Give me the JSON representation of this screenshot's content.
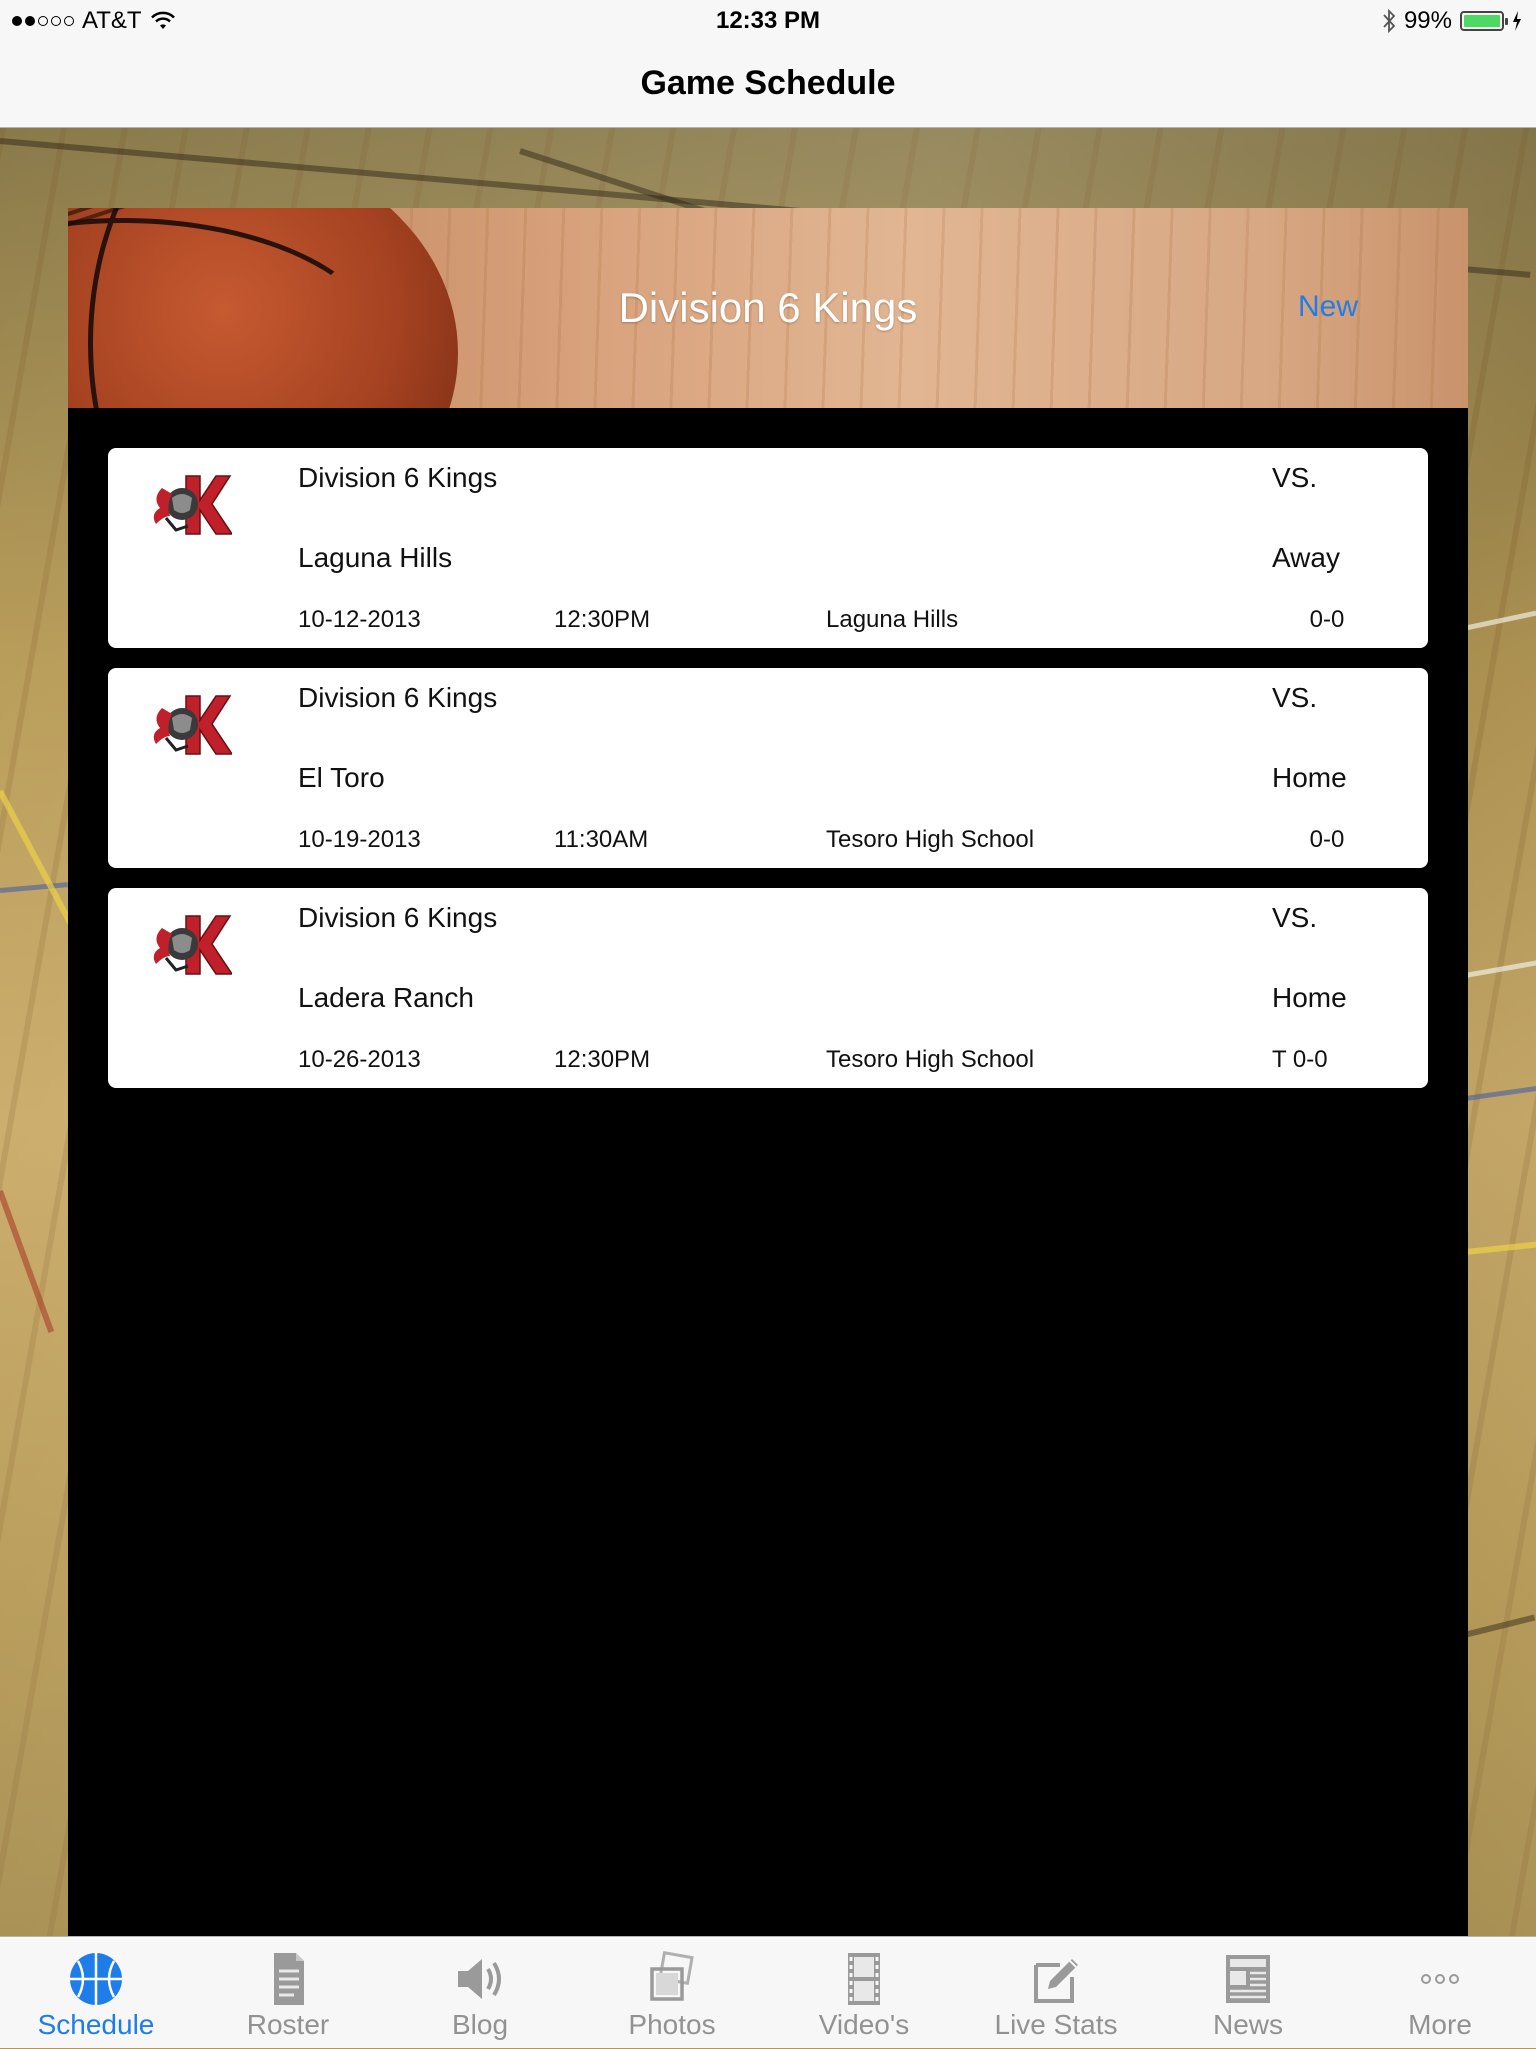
{
  "status_bar": {
    "carrier": "AT&T",
    "time": "12:33 PM",
    "battery_percent": "99%",
    "battery_level": 0.99,
    "signal_bars_filled": 2,
    "signal_bars_total": 5
  },
  "nav": {
    "title": "Game Schedule"
  },
  "header": {
    "title": "Division 6 Kings",
    "new_label": "New"
  },
  "games": [
    {
      "team": "Division 6 Kings",
      "vs": "VS.",
      "opponent": "Laguna Hills",
      "home_away": "Away",
      "date": "10-12-2013",
      "time": "12:30PM",
      "location": "Laguna Hills",
      "score": "0-0"
    },
    {
      "team": "Division 6 Kings",
      "vs": "VS.",
      "opponent": "El Toro",
      "home_away": "Home",
      "date": "10-19-2013",
      "time": "11:30AM",
      "location": "Tesoro High School",
      "score": "0-0"
    },
    {
      "team": "Division 6 Kings",
      "vs": "VS.",
      "opponent": "Ladera Ranch",
      "home_away": "Home",
      "date": "10-26-2013",
      "time": "12:30PM",
      "location": "Tesoro High School",
      "score": "T 0-0"
    }
  ],
  "tabs": [
    {
      "label": "Schedule",
      "icon": "basketball-icon",
      "active": true
    },
    {
      "label": "Roster",
      "icon": "document-icon",
      "active": false
    },
    {
      "label": "Blog",
      "icon": "speaker-icon",
      "active": false
    },
    {
      "label": "Photos",
      "icon": "photos-icon",
      "active": false
    },
    {
      "label": "Video's",
      "icon": "film-icon",
      "active": false
    },
    {
      "label": "Live Stats",
      "icon": "edit-icon",
      "active": false
    },
    {
      "label": "News",
      "icon": "newspaper-icon",
      "active": false
    },
    {
      "label": "More",
      "icon": "more-icon",
      "active": false
    }
  ],
  "colors": {
    "accent": "#1f7dea",
    "inactive_tab": "#929292",
    "panel": "#000000",
    "card": "#ffffff",
    "logo_red": "#c0202a"
  }
}
